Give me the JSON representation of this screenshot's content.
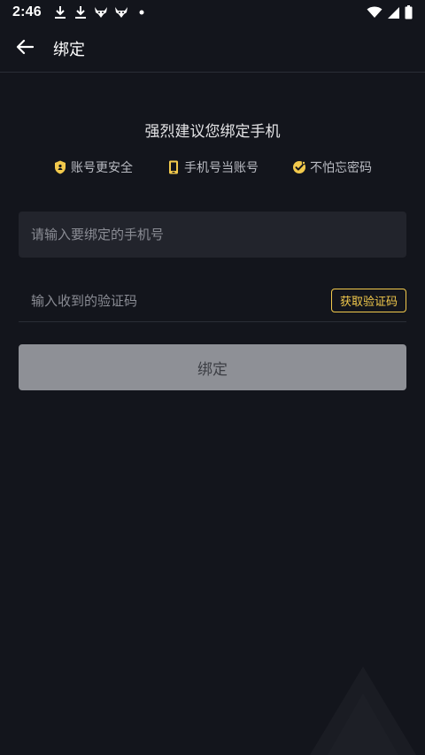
{
  "status_bar": {
    "time": "2:46"
  },
  "app_bar": {
    "title": "绑定"
  },
  "headline": "强烈建议您绑定手机",
  "features": [
    {
      "icon": "shield-icon",
      "label": "账号更安全"
    },
    {
      "icon": "phone-icon",
      "label": "手机号当账号"
    },
    {
      "icon": "check-badge-icon",
      "label": "不怕忘密码"
    }
  ],
  "phone_input": {
    "placeholder": "请输入要绑定的手机号",
    "value": ""
  },
  "code_input": {
    "placeholder": "输入收到的验证码",
    "value": "",
    "get_code_label": "获取验证码"
  },
  "bind_button": {
    "label": "绑定"
  },
  "colors": {
    "background": "#13151c",
    "accent": "#f2c94c",
    "input_bg": "#22242c",
    "button_disabled": "#8e9096"
  }
}
